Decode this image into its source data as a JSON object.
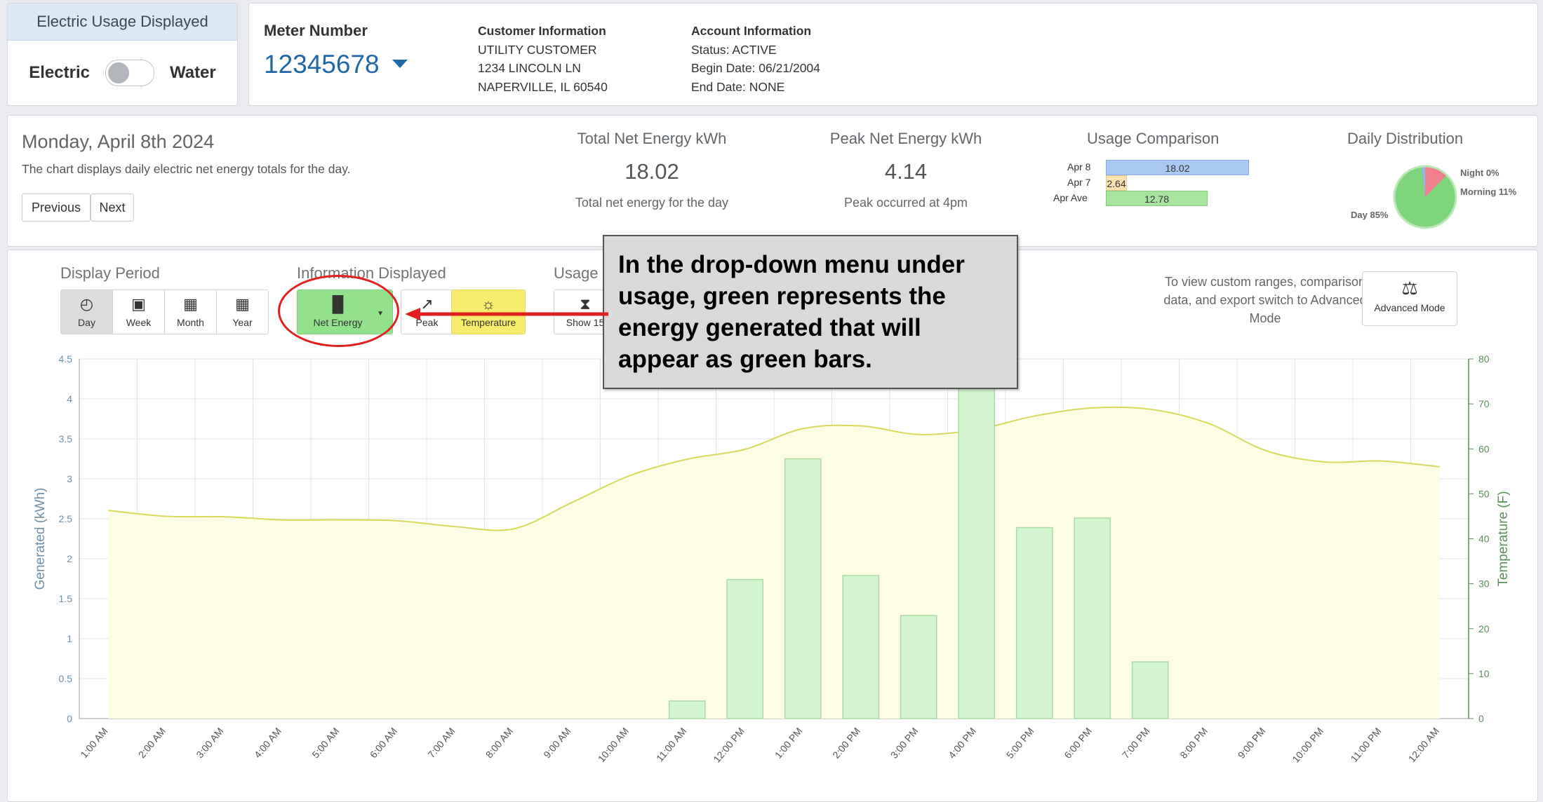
{
  "toggle": {
    "header": "Electric Usage Displayed",
    "left": "Electric",
    "right": "Water"
  },
  "meter": {
    "label": "Meter Number",
    "value": "12345678"
  },
  "customer": {
    "title": "Customer Information",
    "name": "UTILITY CUSTOMER",
    "address1": "1234 LINCOLN LN",
    "address2": "NAPERVILLE, IL 60540"
  },
  "account": {
    "title": "Account Information",
    "status": "Status: ACTIVE",
    "begin": "Begin Date: 06/21/2004",
    "end": "End Date: NONE"
  },
  "summary": {
    "date": "Monday, April 8th 2024",
    "description": "The chart displays daily electric net energy totals for the day.",
    "previous": "Previous",
    "next": "Next",
    "total": {
      "title": "Total Net Energy kWh",
      "value": "18.02",
      "sub": "Total net energy for the day"
    },
    "peak": {
      "title": "Peak Net Energy kWh",
      "value": "4.14",
      "sub": "Peak occurred at 4pm"
    },
    "comparison": {
      "title": "Usage Comparison",
      "rows": [
        {
          "label": "Apr 8",
          "value": "18.02",
          "color": "#a9c9f5"
        },
        {
          "label": "Apr 7",
          "value": "2.64",
          "color": "#fbe3b0"
        },
        {
          "label": "Apr Ave",
          "value": "12.78",
          "color": "#a7e59f"
        }
      ]
    },
    "distribution": {
      "title": "Daily Distribution",
      "night": "Night 0%",
      "morning": "Morning 11%",
      "day": "Day 85%"
    }
  },
  "controls": {
    "display_period_label": "Display Period",
    "periods": [
      "Day",
      "Week",
      "Month",
      "Year"
    ],
    "info_label": "Information Displayed",
    "net_energy": "Net Energy",
    "peak": "Peak",
    "temperature": "Temperature",
    "usage_label": "Usage",
    "show15": "Show 15",
    "advanced_info": "To view custom ranges, comparison data, and export switch to Advanced Mode",
    "advanced_button": "Advanced Mode"
  },
  "callout": "In the drop-down menu under usage, green represents the energy generated that will appear as green bars.",
  "colors": {
    "accent": "#1f68a8",
    "bar": "#d3f5cf",
    "bar_border": "#a8dca1",
    "temp_line": "#d8d85a",
    "temp_fill": "#fcfde3",
    "annotation": "#e11f1f"
  },
  "chart_data": {
    "type": "bar",
    "ylabel": "Generated (kWh)",
    "y2label": "Temperature (F)",
    "ylim": [
      0,
      4.5
    ],
    "y2lim": [
      0,
      80
    ],
    "yticks": [
      "0",
      "0.5",
      "1",
      "1.5",
      "2",
      "2.5",
      "3",
      "3.5",
      "4",
      "4.5"
    ],
    "y2ticks": [
      "0",
      "10",
      "20",
      "30",
      "40",
      "50",
      "60",
      "70",
      "80"
    ],
    "categories": [
      "1:00 AM",
      "2:00 AM",
      "3:00 AM",
      "4:00 AM",
      "5:00 AM",
      "6:00 AM",
      "7:00 AM",
      "8:00 AM",
      "9:00 AM",
      "10:00 AM",
      "11:00 AM",
      "12:00 PM",
      "1:00 PM",
      "2:00 PM",
      "3:00 PM",
      "4:00 PM",
      "5:00 PM",
      "6:00 PM",
      "7:00 PM",
      "8:00 PM",
      "9:00 PM",
      "10:00 PM",
      "11:00 PM",
      "12:00 AM"
    ],
    "series": [
      {
        "values": [
          0,
          0,
          0,
          0,
          0,
          0,
          0,
          0,
          0,
          0,
          0.22,
          1.74,
          3.25,
          1.79,
          1.29,
          4.14,
          2.39,
          2.51,
          0.71,
          0,
          0,
          0,
          0,
          0
        ]
      },
      {
        "values": [
          46.3,
          45,
          44.9,
          44.2,
          44.2,
          44,
          42.7,
          42.2,
          48,
          54,
          57.7,
          59.9,
          64.5,
          65.1,
          63.2,
          64.3,
          67.3,
          69.1,
          68.8,
          65.7,
          59.6,
          57.1,
          57.3,
          56
        ]
      }
    ],
    "grid": true
  }
}
